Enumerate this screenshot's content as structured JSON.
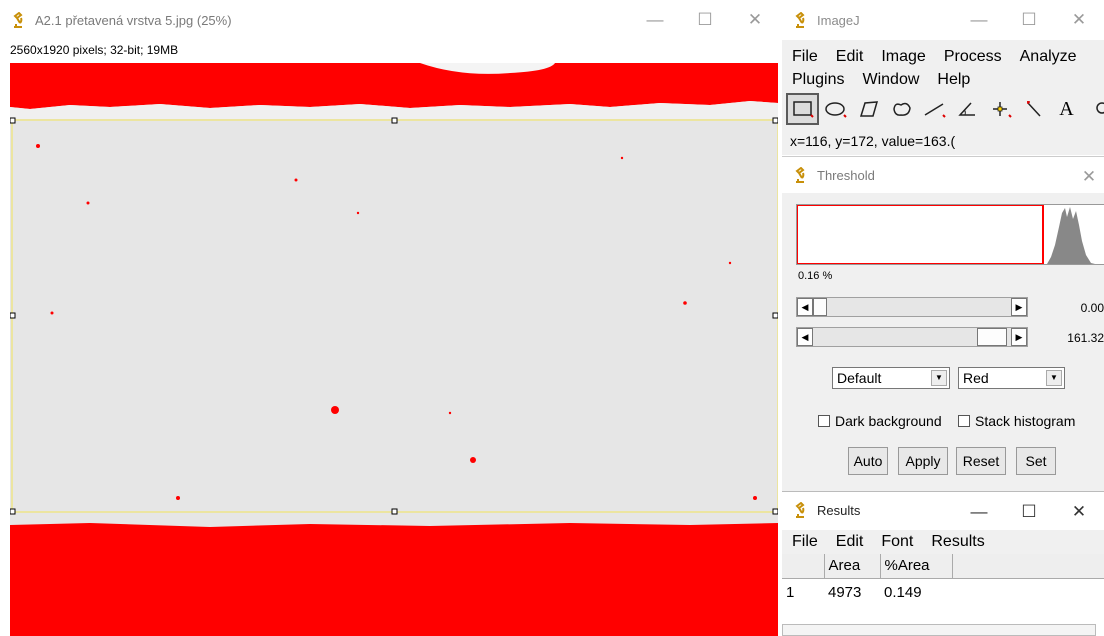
{
  "image_window": {
    "title": "A2.1 přetavená vrstva 5.jpg (25%)",
    "info": "2560x1920 pixels; 32-bit; 19MB",
    "controls": {
      "minimize": "—",
      "maximize": "☐",
      "close": "✕"
    }
  },
  "imagej": {
    "title": "ImageJ",
    "menu_row1": [
      "File",
      "Edit",
      "Image",
      "Process",
      "Analyze"
    ],
    "menu_row2": [
      "Plugins",
      "Window",
      "Help"
    ],
    "tools": [
      "rectangle-tool",
      "oval-tool",
      "polygon-tool",
      "freehand-tool",
      "line-tool",
      "angle-tool",
      "point-tool",
      "wand-tool",
      "text-tool",
      "magnifier-tool"
    ],
    "text_tool_glyph": "A",
    "status": "x=116, y=172, value=163.("
  },
  "threshold": {
    "title": "Threshold",
    "percent": "0.16 %",
    "slider1_value": "0.00",
    "slider2_value": "161.32",
    "method": "Default",
    "display": "Red",
    "dark_background_label": "Dark background",
    "stack_histogram_label": "Stack histogram",
    "buttons": [
      "Auto",
      "Apply",
      "Reset",
      "Set"
    ],
    "overlay_color": "#ff0000"
  },
  "results": {
    "title": "Results",
    "menu": [
      "File",
      "Edit",
      "Font",
      "Results"
    ],
    "columns": [
      "",
      "Area",
      "%Area"
    ],
    "rows": [
      [
        "1",
        "4973",
        "0.149"
      ]
    ]
  }
}
